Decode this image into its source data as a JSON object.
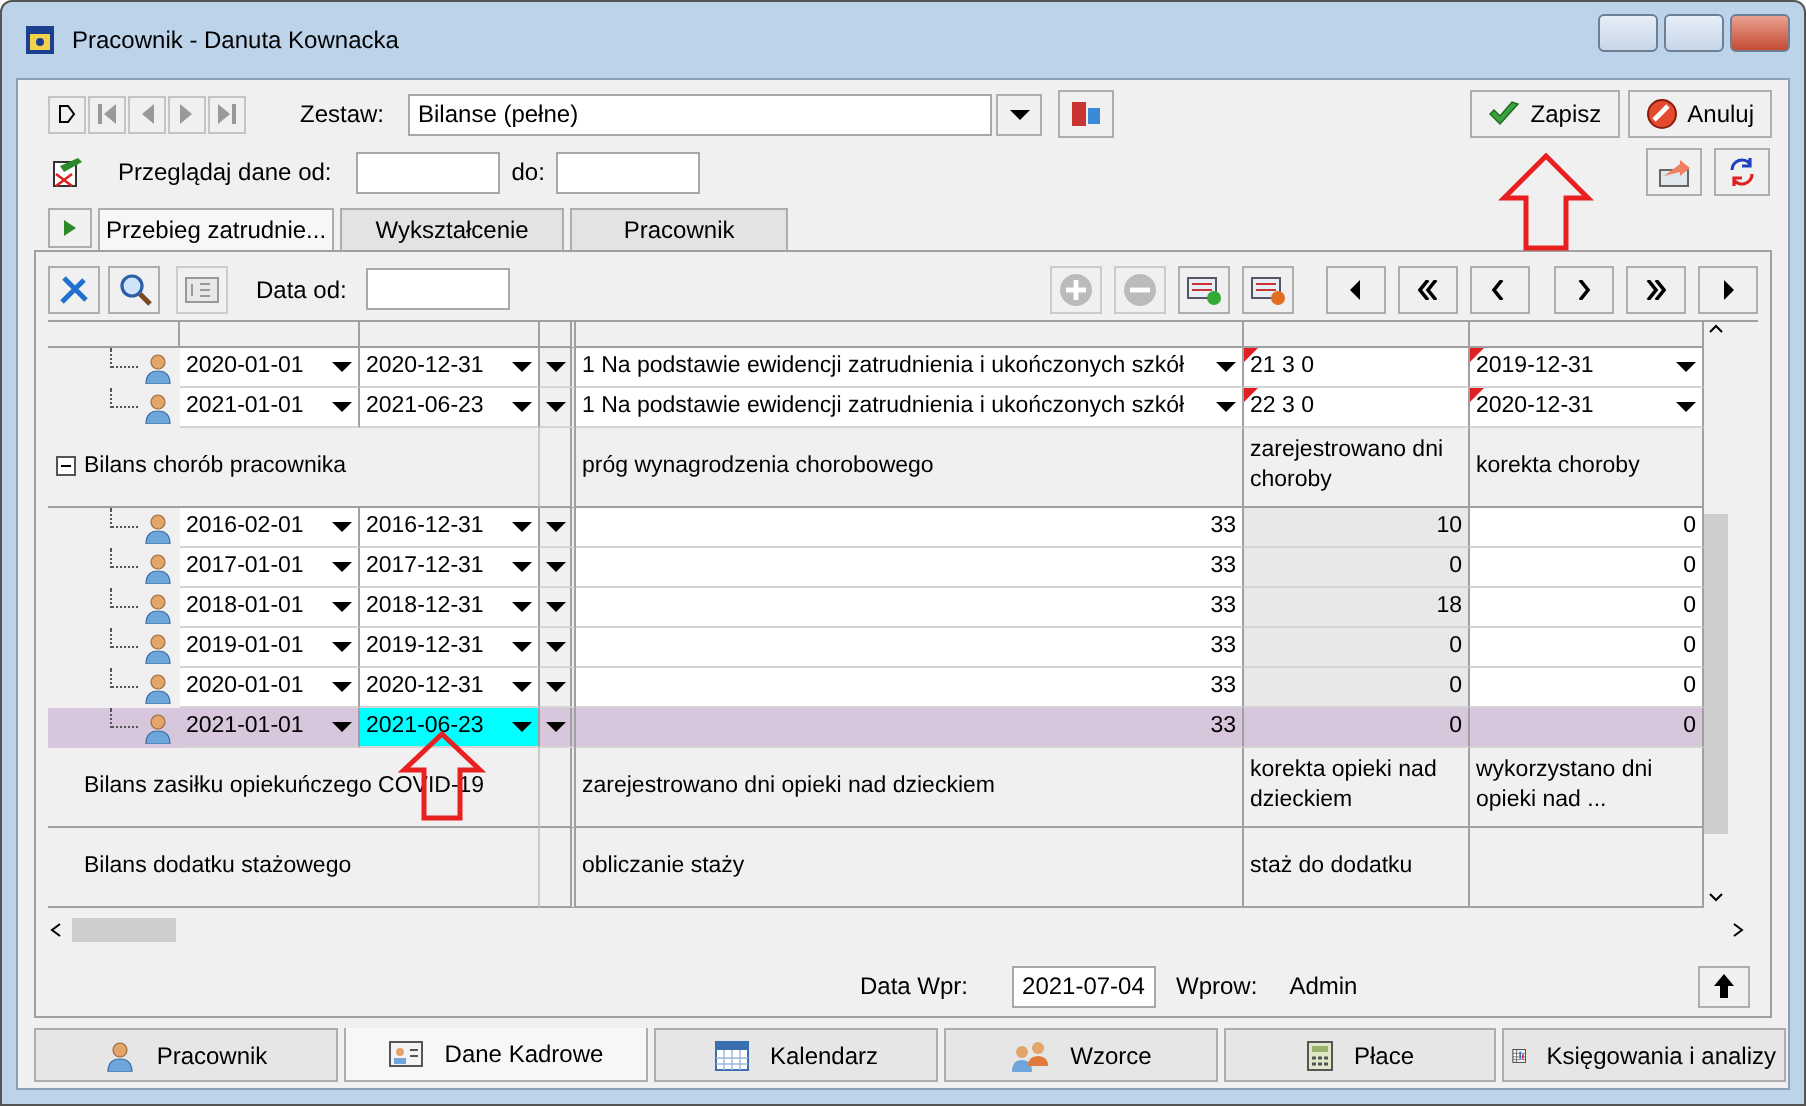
{
  "window": {
    "title": "Pracownik - Danuta Kownacka"
  },
  "toolbar": {
    "zestaw_label": "Zestaw:",
    "zestaw_value": "Bilanse (pełne)",
    "przegladaj_label": "Przeglądaj dane od:",
    "do_label": "do:"
  },
  "buttons": [
    {
      "label": "Zapisz",
      "kind": "save"
    },
    {
      "label": "Anuluj",
      "kind": "cancel"
    }
  ],
  "tabs": [
    {
      "label": "Przebieg zatrudnie...",
      "selected": true
    },
    {
      "label": "Wykształcenie",
      "selected": false
    },
    {
      "label": "Pracownik",
      "selected": false
    }
  ],
  "panel": {
    "data_od_label": "Data od:"
  },
  "grid": {
    "rows": [
      {
        "kind": "record",
        "from": "2020-01-01",
        "to": "2020-12-31",
        "selected": false,
        "to_focused": false,
        "cells": [
          {
            "kind": "combo",
            "value": "1 Na podstawie ewidencji zatrudnienia i ukończonych szkół",
            "flagged": false
          },
          {
            "kind": "text",
            "value": "21  3  0",
            "flagged": true
          },
          {
            "kind": "combo",
            "value": "2019-12-31",
            "flagged": true
          }
        ]
      },
      {
        "kind": "record",
        "from": "2021-01-01",
        "to": "2021-06-23",
        "selected": false,
        "to_focused": false,
        "cells": [
          {
            "kind": "combo",
            "value": "1 Na podstawie ewidencji zatrudnienia i ukończonych szkół",
            "flagged": false
          },
          {
            "kind": "text",
            "value": "22  3  0",
            "flagged": true
          },
          {
            "kind": "combo",
            "value": "2020-12-31",
            "flagged": true
          }
        ]
      },
      {
        "kind": "group",
        "title": "Bilans chorób pracownika",
        "expanded": true,
        "headers": [
          "próg wynagrodzenia chorobowego",
          "zarejestrowano dni choroby",
          "korekta choroby"
        ]
      },
      {
        "kind": "record",
        "from": "2016-02-01",
        "to": "2016-12-31",
        "selected": false,
        "to_focused": false,
        "cells": [
          {
            "kind": "number",
            "value": "33",
            "flagged": false
          },
          {
            "kind": "readonly",
            "value": "10",
            "flagged": false
          },
          {
            "kind": "number",
            "value": "0",
            "flagged": false
          }
        ]
      },
      {
        "kind": "record",
        "from": "2017-01-01",
        "to": "2017-12-31",
        "selected": false,
        "to_focused": false,
        "cells": [
          {
            "kind": "number",
            "value": "33",
            "flagged": false
          },
          {
            "kind": "readonly",
            "value": "0",
            "flagged": false
          },
          {
            "kind": "number",
            "value": "0",
            "flagged": false
          }
        ]
      },
      {
        "kind": "record",
        "from": "2018-01-01",
        "to": "2018-12-31",
        "selected": false,
        "to_focused": false,
        "cells": [
          {
            "kind": "number",
            "value": "33",
            "flagged": false
          },
          {
            "kind": "readonly",
            "value": "18",
            "flagged": false
          },
          {
            "kind": "number",
            "value": "0",
            "flagged": false
          }
        ]
      },
      {
        "kind": "record",
        "from": "2019-01-01",
        "to": "2019-12-31",
        "selected": false,
        "to_focused": false,
        "cells": [
          {
            "kind": "number",
            "value": "33",
            "flagged": false
          },
          {
            "kind": "readonly",
            "value": "0",
            "flagged": false
          },
          {
            "kind": "number",
            "value": "0",
            "flagged": false
          }
        ]
      },
      {
        "kind": "record",
        "from": "2020-01-01",
        "to": "2020-12-31",
        "selected": false,
        "to_focused": false,
        "cells": [
          {
            "kind": "number",
            "value": "33",
            "flagged": false
          },
          {
            "kind": "readonly",
            "value": "0",
            "flagged": false
          },
          {
            "kind": "number",
            "value": "0",
            "flagged": false
          }
        ]
      },
      {
        "kind": "record",
        "from": "2021-01-01",
        "to": "2021-06-23",
        "selected": true,
        "to_focused": true,
        "cells": [
          {
            "kind": "number",
            "value": "33",
            "flagged": false
          },
          {
            "kind": "readonly",
            "value": "0",
            "flagged": false
          },
          {
            "kind": "number",
            "value": "0",
            "flagged": false
          }
        ]
      },
      {
        "kind": "group",
        "title": "Bilans zasiłku opiekuńczego COVID-19",
        "headers": [
          "zarejestrowano dni opieki nad dzieckiem",
          "korekta opieki nad dzieckiem",
          "wykorzystano dni opieki nad ..."
        ]
      },
      {
        "kind": "group",
        "title": "Bilans dodatku stażowego",
        "headers": [
          "obliczanie staży",
          "staż do dodatku"
        ]
      }
    ]
  },
  "footer": {
    "data_wpr_label": "Data Wpr:",
    "data_wpr_value": "2021-07-04",
    "wprow_label": "Wprow:",
    "wprow_value": "Admin"
  },
  "bottom_tabs": [
    {
      "label": "Pracownik",
      "kind": "person",
      "selected": false
    },
    {
      "label": "Dane Kadrowe",
      "kind": "card",
      "selected": true
    },
    {
      "label": "Kalendarz",
      "kind": "calendar",
      "selected": false
    },
    {
      "label": "Wzorce",
      "kind": "people",
      "selected": false
    },
    {
      "label": "Płace",
      "kind": "calculator",
      "selected": false
    },
    {
      "label": "Księgowania i analizy",
      "kind": "ledger",
      "selected": false
    }
  ]
}
